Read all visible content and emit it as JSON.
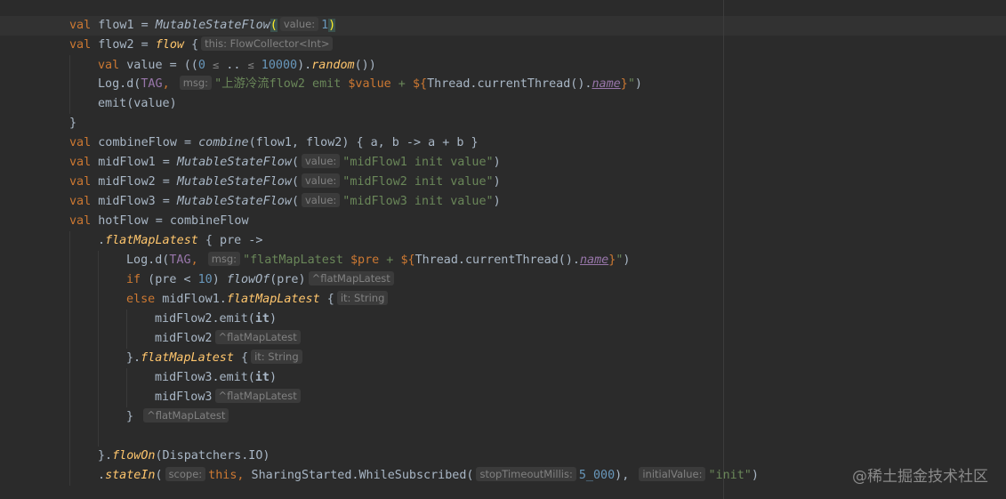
{
  "watermark": "@稀土掘金技术社区",
  "code": {
    "l1": {
      "kw": "val",
      "name": " flow1 = ",
      "fn": "MutableStateFlow",
      "open": "(",
      "hint": "value:",
      "num": "1",
      "close": ")"
    },
    "l2": {
      "kw": "val",
      "name": " flow2 = ",
      "fn": "flow",
      "open": " {",
      "hint": "this: FlowCollector<Int>"
    },
    "l3": {
      "kw": "val",
      "name": " value = ((",
      "n0": "0",
      "op1": "≤",
      "dots": " .. ",
      "op2": "≤",
      "n1": "10000",
      "mid": ").",
      "fn": "random",
      "end": "())"
    },
    "l4": {
      "a": "Log.d(",
      "tag": "TAG",
      "comma": ",",
      "hint": "msg:",
      "s1": "\"上游冷流flow2 emit ",
      "var": "$value",
      "s2": " + ",
      "tmpl": "${",
      "b": "Thread.currentThread().",
      "prop": "name",
      "tmplend": "}",
      "s3": "\"",
      "end": ")"
    },
    "l5": {
      "a": "emit(value)"
    },
    "l6": {
      "a": "}"
    },
    "l7": {
      "kw": "val",
      "name": " combineFlow = ",
      "fn": "combine",
      "rest": "(flow1, flow2) { a, b -> a + b }"
    },
    "l8": {
      "kw": "val",
      "name": " midFlow1 = ",
      "fn": "MutableStateFlow",
      "open": "(",
      "hint": "value:",
      "str": "\"midFlow1 init value\"",
      "close": ")"
    },
    "l9": {
      "kw": "val",
      "name": " midFlow2 = ",
      "fn": "MutableStateFlow",
      "open": "(",
      "hint": "value:",
      "str": "\"midFlow2 init value\"",
      "close": ")"
    },
    "l10": {
      "kw": "val",
      "name": " midFlow3 = ",
      "fn": "MutableStateFlow",
      "open": "(",
      "hint": "value:",
      "str": "\"midFlow3 init value\"",
      "close": ")"
    },
    "l11": {
      "kw": "val",
      "name": " hotFlow = combineFlow"
    },
    "l12": {
      "dot": ".",
      "fn": "flatMapLatest",
      "rest": " { pre ->"
    },
    "l13": {
      "a": "Log.d(",
      "tag": "TAG",
      "comma": ",",
      "hint": "msg:",
      "s1": "\"flatMapLatest ",
      "var": "$pre",
      "s2": " + ",
      "tmpl": "${",
      "b": "Thread.currentThread().",
      "prop": "name",
      "tmplend": "}",
      "s3": "\"",
      "end": ")"
    },
    "l14": {
      "kw": "if",
      "a": " (pre < ",
      "num": "10",
      "b": ") ",
      "fn": "flowOf",
      "c": "(pre)",
      "hint": "^flatMapLatest"
    },
    "l15": {
      "kw": "else",
      "a": " midFlow1.",
      "fn": "flatMapLatest",
      "b": " {",
      "hint": "it: String"
    },
    "l16": {
      "a": "midFlow2.emit(",
      "it": "it",
      "b": ")"
    },
    "l17": {
      "a": "midFlow2",
      "hint": "^flatMapLatest"
    },
    "l18": {
      "a": "}.",
      "fn": "flatMapLatest",
      "b": " {",
      "hint": "it: String"
    },
    "l19": {
      "a": "midFlow3.emit(",
      "it": "it",
      "b": ")"
    },
    "l20": {
      "a": "midFlow3",
      "hint": "^flatMapLatest"
    },
    "l21": {
      "a": "}",
      "hint": "^flatMapLatest"
    },
    "l23": {
      "a": "}.",
      "fn": "flowOn",
      "b": "(Dispatchers.IO)"
    },
    "l24": {
      "dot": ".",
      "fn": "stateIn",
      "a": "(",
      "hint1": "scope:",
      "kw": "this,",
      "b": " SharingStarted.WhileSubscribed(",
      "hint2": "stopTimeoutMillis:",
      "num": "5_000",
      "c": "),",
      "hint3": "initialValue:",
      "str": "\"init\"",
      "d": ")"
    }
  }
}
